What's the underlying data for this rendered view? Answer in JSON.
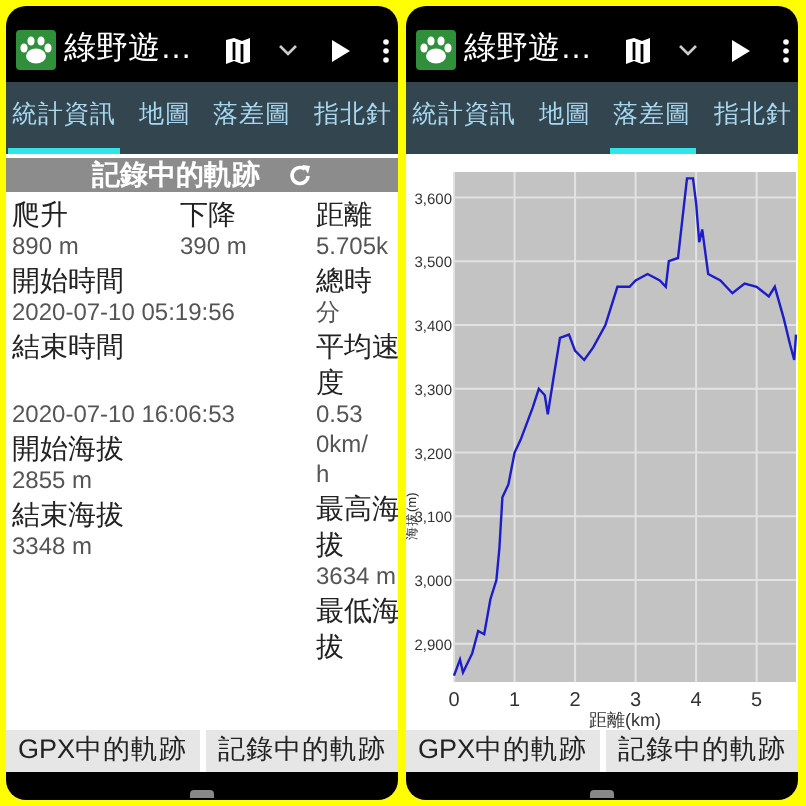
{
  "panels": [
    {
      "app_bar": {
        "title": "綠野遊…"
      },
      "tabs": [
        {
          "label": "統計資訊",
          "selected": true
        },
        {
          "label": "地圖",
          "selected": false
        },
        {
          "label": "落差圖",
          "selected": false
        },
        {
          "label": "指北針",
          "selected": false
        }
      ],
      "content": {
        "kind": "stats",
        "header": "記錄中的軌跡",
        "grid": [
          {
            "cells": [
              {
                "label": "爬升",
                "value": "890 m"
              },
              {
                "label": "下降",
                "value": "390 m"
              },
              {
                "label": "距離",
                "value": "5.705k"
              }
            ]
          },
          {
            "cells": [
              {
                "label": "開始時間",
                "value": "2020-07-10 05:19:56"
              },
              null,
              {
                "label": "總時",
                "value": "分"
              }
            ]
          },
          {
            "cells": [
              {
                "label": "結束時間"
              },
              null,
              {
                "label": "平均速度"
              }
            ]
          }
        ],
        "columns": [
          [
            {
              "kind": "value",
              "text": "2020-07-10 16:06:53"
            },
            {
              "kind": "label",
              "text": "開始海拔"
            },
            {
              "kind": "value",
              "text": "2855 m"
            },
            {
              "kind": "label",
              "text": "結束海拔"
            },
            {
              "kind": "value",
              "text": "3348 m"
            }
          ],
          [
            {
              "kind": "value",
              "text": "0.53"
            },
            {
              "kind": "value",
              "text": "0km/"
            },
            {
              "kind": "value",
              "text": "h"
            },
            {
              "kind": "label",
              "text": "最高海拔"
            },
            {
              "kind": "value",
              "text": "3634 m"
            },
            {
              "kind": "label",
              "text": "最低海拔"
            }
          ]
        ]
      },
      "buttons": [
        {
          "label": "GPX中的軌跡"
        },
        {
          "label": "記錄中的軌跡"
        }
      ]
    },
    {
      "app_bar": {
        "title": "綠野遊…"
      },
      "tabs": [
        {
          "label": "統計資訊",
          "selected": false
        },
        {
          "label": "地圖",
          "selected": false
        },
        {
          "label": "落差圖",
          "selected": true
        },
        {
          "label": "指北針",
          "selected": false
        }
      ],
      "content": {
        "kind": "chart",
        "chart_data": {
          "type": "line",
          "xlabel": "距離(km)",
          "ylabel": "海拔(m)",
          "x": [
            0,
            0.1,
            0.15,
            0.3,
            0.4,
            0.5,
            0.6,
            0.7,
            0.75,
            0.8,
            0.9,
            1.0,
            1.1,
            1.3,
            1.4,
            1.5,
            1.55,
            1.65,
            1.75,
            1.9,
            2.0,
            2.15,
            2.3,
            2.5,
            2.7,
            2.9,
            3.0,
            3.2,
            3.4,
            3.5,
            3.55,
            3.7,
            3.85,
            3.95,
            4.0,
            4.05,
            4.1,
            4.2,
            4.4,
            4.6,
            4.8,
            5.0,
            5.2,
            5.3,
            5.45,
            5.55,
            5.62,
            5.65
          ],
          "grid": true,
          "series": [
            {
              "color": "#1c1cc8",
              "values": [
                2850,
                2875,
                2855,
                2885,
                2920,
                2915,
                2970,
                3000,
                3050,
                3130,
                3150,
                3200,
                3220,
                3270,
                3300,
                3290,
                3260,
                3320,
                3380,
                3385,
                3360,
                3345,
                3365,
                3400,
                3460,
                3460,
                3470,
                3480,
                3470,
                3460,
                3500,
                3505,
                3630,
                3630,
                3590,
                3530,
                3550,
                3480,
                3470,
                3450,
                3465,
                3460,
                3445,
                3460,
                3410,
                3370,
                3345,
                3385
              ]
            }
          ],
          "xlim": [
            0,
            5.65
          ],
          "ylim": [
            2840,
            3640
          ],
          "xticks": [
            0,
            1,
            2,
            3,
            4,
            5
          ],
          "yticks": [
            {
              "value": 2900,
              "label": "2,900"
            },
            {
              "value": 3000,
              "label": "3,000"
            },
            {
              "value": 3100,
              "label": "3,100"
            },
            {
              "value": 3200,
              "label": "3,200"
            },
            {
              "value": 3300,
              "label": "3,300"
            },
            {
              "value": 3400,
              "label": "3,400"
            },
            {
              "value": 3500,
              "label": "3,500"
            },
            {
              "value": 3600,
              "label": "3,600"
            }
          ]
        }
      },
      "buttons": [
        {
          "label": "GPX中的軌跡"
        },
        {
          "label": "記錄中的軌跡"
        }
      ]
    }
  ]
}
